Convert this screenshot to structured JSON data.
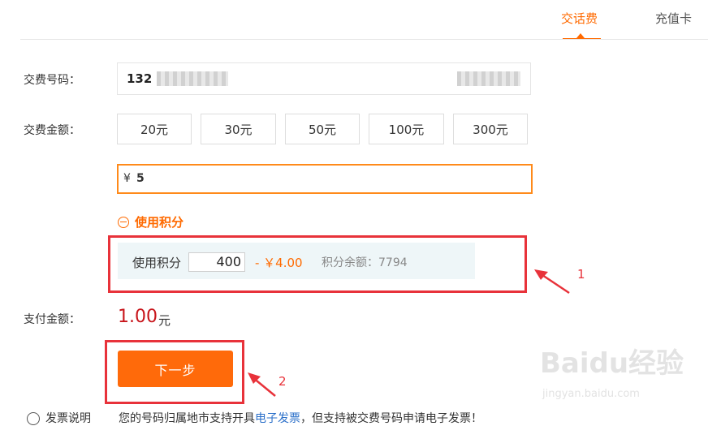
{
  "tabs": [
    {
      "label": "交话费",
      "active": true
    },
    {
      "label": "充值卡",
      "active": false
    }
  ],
  "form": {
    "phone_label": "交费号码：",
    "phone_prefix": "132",
    "amount_label": "交费金额：",
    "amount_options": [
      "20元",
      "30元",
      "50元",
      "100元",
      "300元"
    ],
    "currency_symbol": "¥",
    "custom_amount": "5",
    "points_toggle_label": "使用积分",
    "points": {
      "label": "使用积分",
      "value": "400",
      "discount": "- ￥4.00",
      "balance": "积分余额：7794"
    },
    "pay_label": "支付金额：",
    "pay_value": "1.00",
    "pay_unit": "元",
    "next_button": "下一步"
  },
  "annotations": {
    "label_1": "1",
    "label_2": "2"
  },
  "note": {
    "title": "发票说明",
    "text_before": "您的号码归属地市支持开具",
    "link": "电子发票",
    "text_after": "，但支持被交费号码申请电子发票！"
  },
  "watermark": {
    "main": "Baidu经验",
    "sub": "jingyan.baidu.com"
  },
  "colors": {
    "accent": "#ff6a00",
    "annotation_red": "#e8323a",
    "price_red": "#c8151b",
    "link_blue": "#2a6fc9"
  }
}
